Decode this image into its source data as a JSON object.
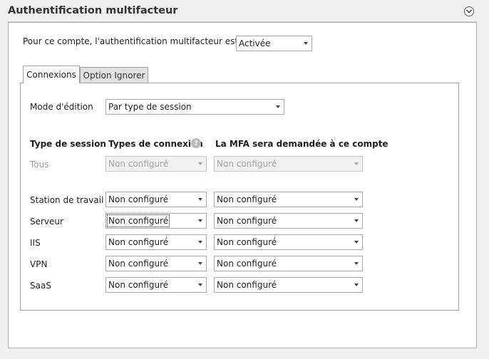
{
  "header": {
    "title": "Authentification multifacteur",
    "collapse_icon": "chevron-down-circle-icon"
  },
  "mfa_status": {
    "label": "Pour ce compte, l'authentification multifacteur est",
    "value": "Activée"
  },
  "tabs": [
    {
      "label": "Connexions",
      "active": true
    },
    {
      "label": "Option Ignorer",
      "active": false
    }
  ],
  "edit_mode": {
    "label": "Mode d'édition",
    "value": "Par type de session"
  },
  "table": {
    "headers": {
      "session_type": "Type de session",
      "connection_types": "Types de connexion",
      "mfa_required": "La MFA sera demandée à ce compte"
    },
    "all_row": {
      "label": "Tous",
      "connection_type": "Non configuré",
      "mfa_required": "Non configuré",
      "disabled": true
    },
    "rows": [
      {
        "label": "Station de travail",
        "connection_type": "Non configuré",
        "mfa_required": "Non configuré"
      },
      {
        "label": "Serveur",
        "connection_type": "Non configuré",
        "mfa_required": "Non configuré",
        "focused": true
      },
      {
        "label": "IIS",
        "connection_type": "Non configuré",
        "mfa_required": "Non configuré"
      },
      {
        "label": "VPN",
        "connection_type": "Non configuré",
        "mfa_required": "Non configuré"
      },
      {
        "label": "SaaS",
        "connection_type": "Non configuré",
        "mfa_required": "Non configuré"
      }
    ]
  },
  "help_icon": {
    "name": "help-icon",
    "glyph": "?"
  }
}
